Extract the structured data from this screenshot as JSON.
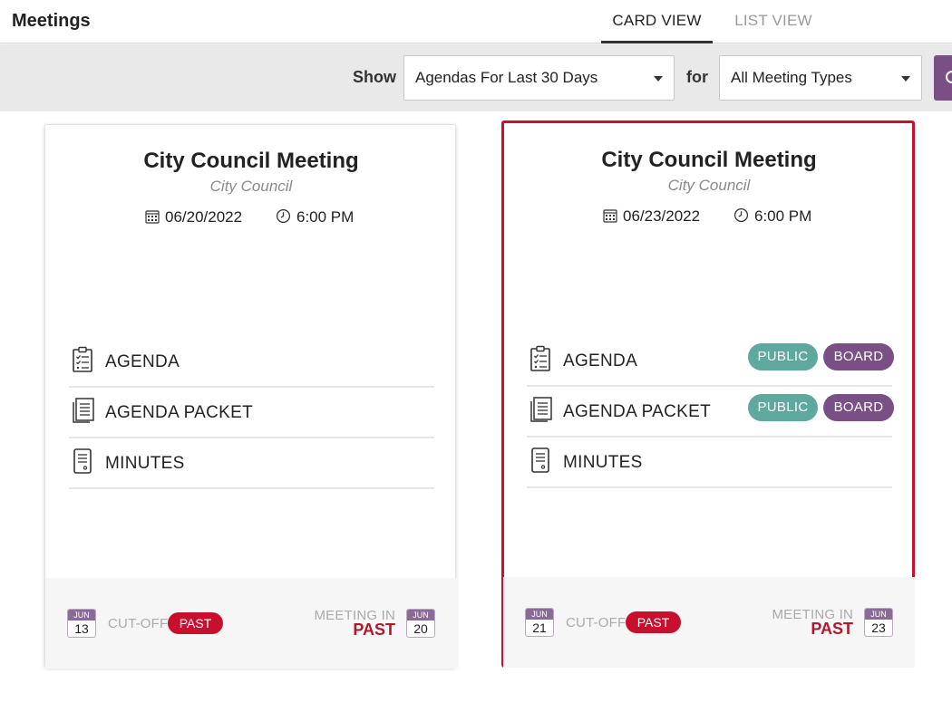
{
  "header": {
    "title": "Meetings",
    "tabs": [
      {
        "label": "CARD VIEW",
        "active": true
      },
      {
        "label": "LIST VIEW",
        "active": false
      }
    ]
  },
  "filters": {
    "show_label": "Show",
    "range_value": "Agendas For Last 30 Days",
    "for_label": "for",
    "type_value": "All Meeting Types"
  },
  "colors": {
    "accent_purple": "#7a4f86",
    "public_teal": "#5ea89d",
    "past_red": "#c8102e",
    "selected_border": "#c8102e"
  },
  "cards": [
    {
      "title": "City Council Meeting",
      "body": "City Council",
      "date": "06/20/2022",
      "time": "6:00 PM",
      "selected": false,
      "documents": [
        {
          "icon": "agenda-checklist-icon",
          "label": "AGENDA",
          "badges": []
        },
        {
          "icon": "agenda-packet-icon",
          "label": "AGENDA PACKET",
          "badges": []
        },
        {
          "icon": "minutes-document-icon",
          "label": "MINUTES",
          "badges": []
        }
      ],
      "footer": {
        "cutoff_month": "JUN",
        "cutoff_day": "13",
        "cutoff_label": "CUT-OFF",
        "cutoff_status": "PAST",
        "meeting_in_label": "MEETING IN",
        "meeting_status": "PAST",
        "meeting_month": "JUN",
        "meeting_day": "20"
      }
    },
    {
      "title": "City Council Meeting",
      "body": "City Council",
      "date": "06/23/2022",
      "time": "6:00 PM",
      "selected": true,
      "documents": [
        {
          "icon": "agenda-checklist-icon",
          "label": "AGENDA",
          "badges": [
            "PUBLIC",
            "BOARD"
          ]
        },
        {
          "icon": "agenda-packet-icon",
          "label": "AGENDA PACKET",
          "badges": [
            "PUBLIC",
            "BOARD"
          ]
        },
        {
          "icon": "minutes-document-icon",
          "label": "MINUTES",
          "badges": []
        }
      ],
      "footer": {
        "cutoff_month": "JUN",
        "cutoff_day": "21",
        "cutoff_label": "CUT-OFF",
        "cutoff_status": "PAST",
        "meeting_in_label": "MEETING IN",
        "meeting_status": "PAST",
        "meeting_month": "JUN",
        "meeting_day": "23"
      }
    }
  ]
}
